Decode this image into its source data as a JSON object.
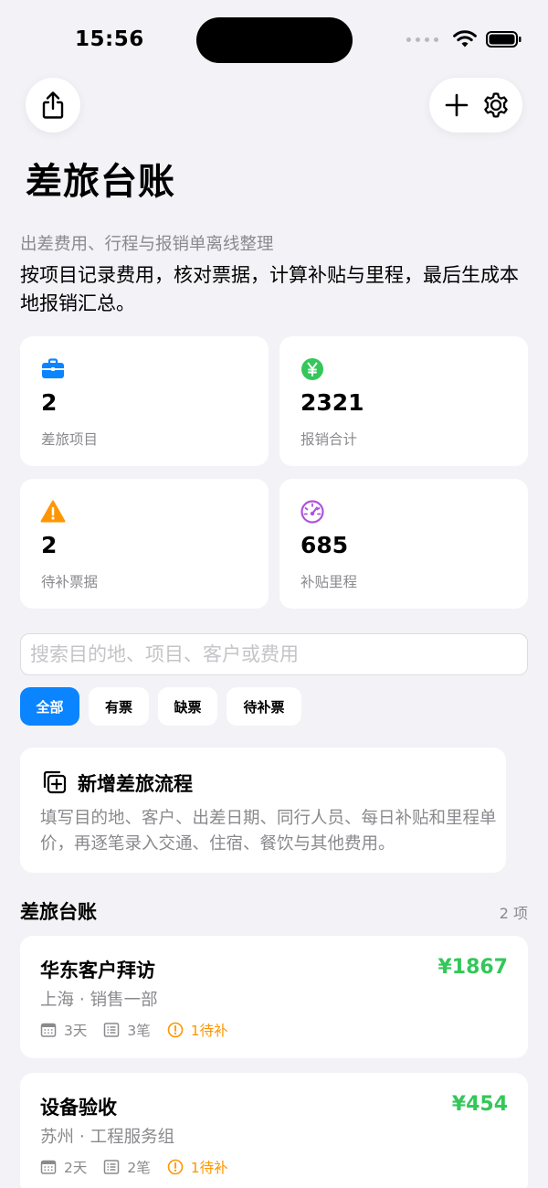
{
  "status_bar": {
    "time": "15:56"
  },
  "header": {
    "title": "差旅台账",
    "subtitle": "出差费用、行程与报销单离线整理",
    "description": "按项目记录费用，核对票据，计算补贴与里程，最后生成本地报销汇总。"
  },
  "stats": [
    {
      "icon": "briefcase-icon",
      "value": "2",
      "label": "差旅项目",
      "color": "#0a84ff"
    },
    {
      "icon": "yen-circle-icon",
      "value": "2321",
      "label": "报销合计",
      "color": "#34c759"
    },
    {
      "icon": "warning-triangle-icon",
      "value": "2",
      "label": "待补票据",
      "color": "#ff9500"
    },
    {
      "icon": "speedometer-icon",
      "value": "685",
      "label": "补贴里程",
      "color": "#af52de"
    }
  ],
  "search": {
    "placeholder": "搜索目的地、项目、客户或费用",
    "value": ""
  },
  "filters": [
    {
      "label": "全部",
      "active": true
    },
    {
      "label": "有票",
      "active": false
    },
    {
      "label": "缺票",
      "active": false
    },
    {
      "label": "待补票",
      "active": false
    }
  ],
  "new_flow": {
    "title": "新增差旅流程",
    "description": "填写目的地、客户、出差日期、同行人员、每日补贴和里程单价，再逐笔录入交通、住宿、餐饮与其他费用。"
  },
  "ledger": {
    "title": "差旅台账",
    "count": "2 项",
    "trips": [
      {
        "name": "华东客户拜访",
        "amount": "¥1867",
        "location": "上海 · 销售一部",
        "days": "3天",
        "entries": "3笔",
        "pending": "1待补"
      },
      {
        "name": "设备验收",
        "amount": "¥454",
        "location": "苏州 · 工程服务组",
        "days": "2天",
        "entries": "2笔",
        "pending": "1待补"
      }
    ]
  },
  "colors": {
    "accent": "#0a84ff",
    "amount": "#34c759",
    "warning": "#ff9500",
    "background": "#f2f2f7"
  }
}
